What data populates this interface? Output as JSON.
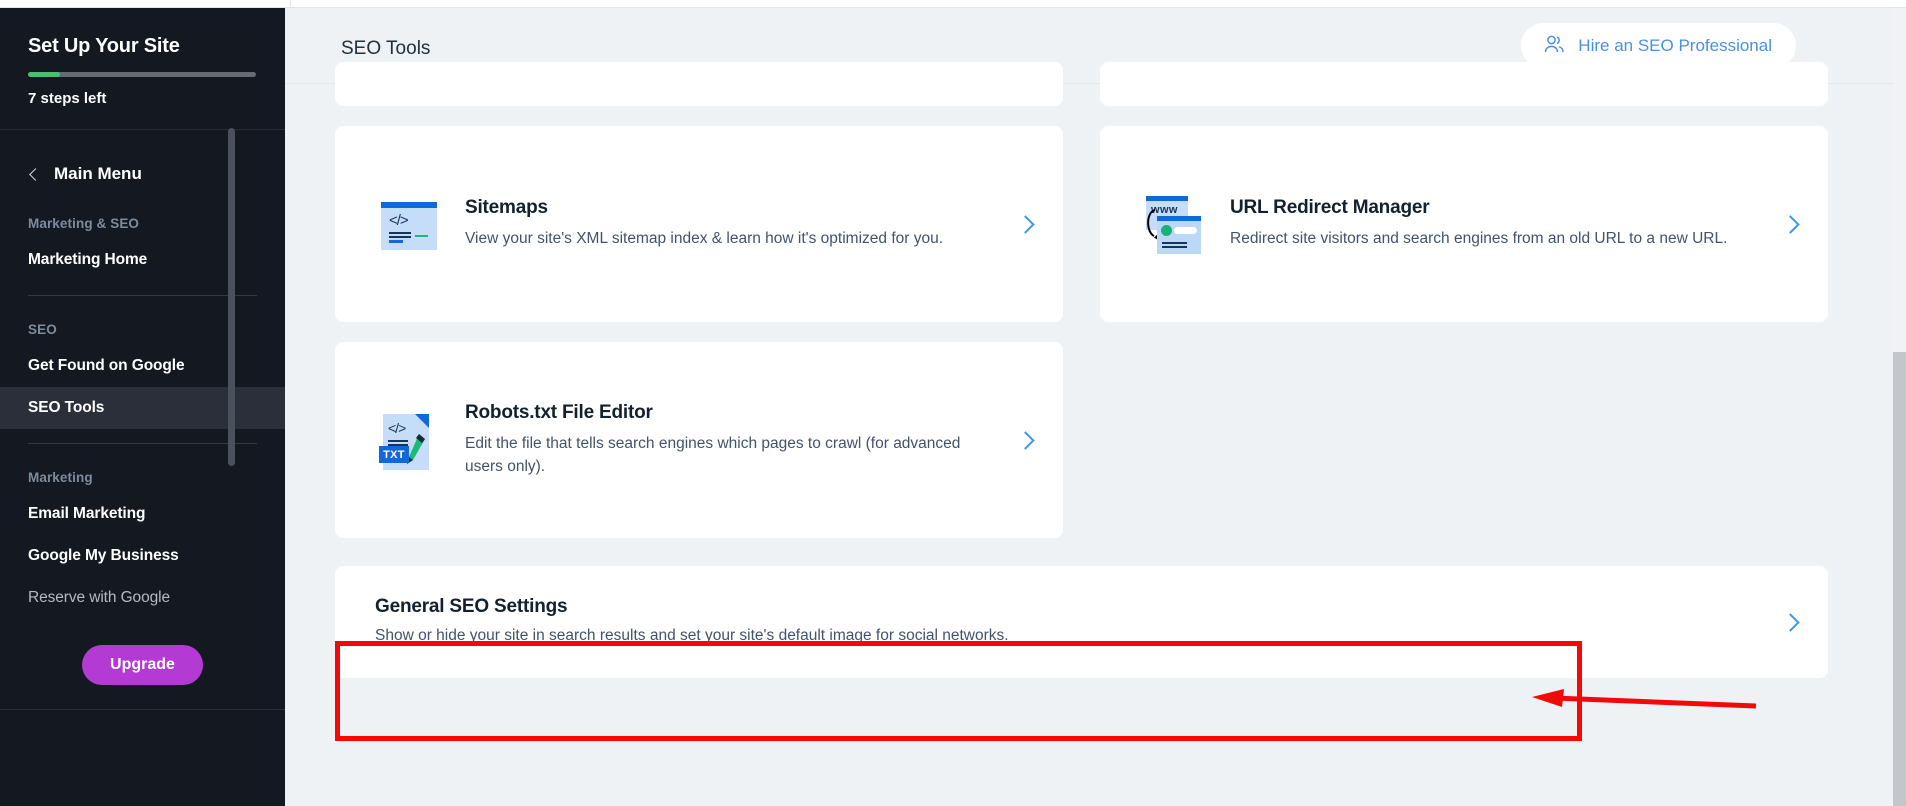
{
  "sidebar": {
    "setup": {
      "title": "Set Up Your Site",
      "steps_left": "7 steps left",
      "progress_percent": 14
    },
    "main_menu_label": "Main Menu",
    "sections": [
      {
        "title": "Marketing & SEO",
        "items": [
          {
            "label": "Marketing Home",
            "state": "default"
          }
        ]
      },
      {
        "title": "SEO",
        "items": [
          {
            "label": "Get Found on Google",
            "state": "default"
          },
          {
            "label": "SEO Tools",
            "state": "active"
          }
        ]
      },
      {
        "title": "Marketing",
        "items": [
          {
            "label": "Email Marketing",
            "state": "default"
          },
          {
            "label": "Google My Business",
            "state": "default"
          },
          {
            "label": "Reserve with Google",
            "state": "muted"
          }
        ]
      }
    ],
    "upgrade_label": "Upgrade",
    "colors": {
      "background": "#141921",
      "active_item": "#2a2f39",
      "progress_fill": "#4dbd74",
      "upgrade": "#b33bd4"
    }
  },
  "header": {
    "title": "SEO Tools",
    "hire_button": {
      "label": "Hire an SEO Professional",
      "icon": "users-icon",
      "color": "#4a90e2"
    }
  },
  "cards": [
    {
      "id": "sitemaps",
      "title": "Sitemaps",
      "description": "View your site's XML sitemap index & learn how it's optimized for you.",
      "icon": "sitemap-code-document-icon",
      "chevron": "chevron-right-icon"
    },
    {
      "id": "redirect",
      "title": "URL Redirect Manager",
      "description": "Redirect site visitors and search engines from an old URL to a new URL.",
      "icon": "url-redirect-windows-icon",
      "icon_text": "www",
      "chevron": "chevron-right-icon"
    },
    {
      "id": "robots",
      "title": "Robots.txt File Editor",
      "description": "Edit the file that tells search engines which pages to crawl (for advanced users only).",
      "icon": "robots-txt-document-pencil-icon",
      "icon_badge": "TXT",
      "chevron": "chevron-right-icon"
    },
    {
      "id": "general",
      "title": "General SEO Settings",
      "description": "Show or hide your site in search results and set your site's default image for social networks.",
      "icon": "none",
      "chevron": "chevron-right-icon"
    }
  ],
  "annotations": {
    "highlight_color": "#f50808",
    "highlight_target": "General SEO Settings",
    "arrow_direction": "left"
  }
}
